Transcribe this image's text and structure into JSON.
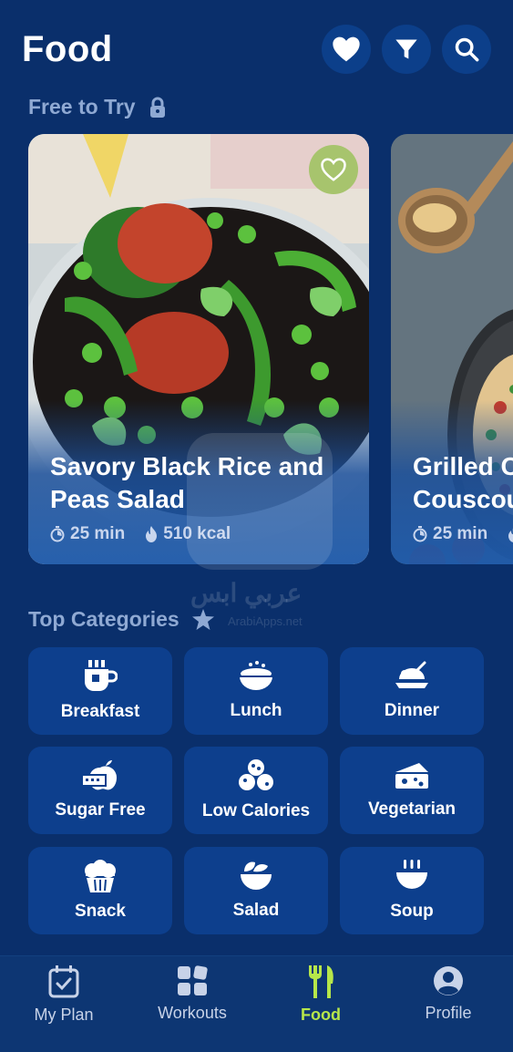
{
  "header": {
    "title": "Food"
  },
  "sections": {
    "free_to_try": "Free to Try",
    "top_categories": "Top Categories"
  },
  "cards": [
    {
      "title": "Savory Black Rice and Peas Salad",
      "time": "25 min",
      "kcal": "510 kcal"
    },
    {
      "title": "Grilled C... Couscou...",
      "title_line1": "Grilled C",
      "title_line2": "Couscou",
      "time": "25 min"
    }
  ],
  "categories": [
    {
      "label": "Breakfast",
      "icon": "coffee-cup-icon"
    },
    {
      "label": "Lunch",
      "icon": "bowl-icon"
    },
    {
      "label": "Dinner",
      "icon": "dinner-plate-icon"
    },
    {
      "label": "Sugar Free",
      "icon": "sugar-free-icon"
    },
    {
      "label": "Low Calories",
      "icon": "low-calories-icon"
    },
    {
      "label": "Vegetarian",
      "icon": "cheese-icon"
    },
    {
      "label": "Snack",
      "icon": "cupcake-icon"
    },
    {
      "label": "Salad",
      "icon": "salad-icon"
    },
    {
      "label": "Soup",
      "icon": "soup-icon"
    }
  ],
  "tabs": [
    {
      "label": "My Plan",
      "icon": "calendar-check-icon"
    },
    {
      "label": "Workouts",
      "icon": "grid-icon"
    },
    {
      "label": "Food",
      "icon": "fork-knife-icon",
      "active": true
    },
    {
      "label": "Profile",
      "icon": "person-icon"
    }
  ],
  "watermark": {
    "text": "عربي ابس",
    "subtext": "ArabiApps.net"
  },
  "colors": {
    "background": "#0a2f6b",
    "tile": "#0d3f8d",
    "accent": "#b6e64a",
    "fav": "#a7c46d"
  }
}
